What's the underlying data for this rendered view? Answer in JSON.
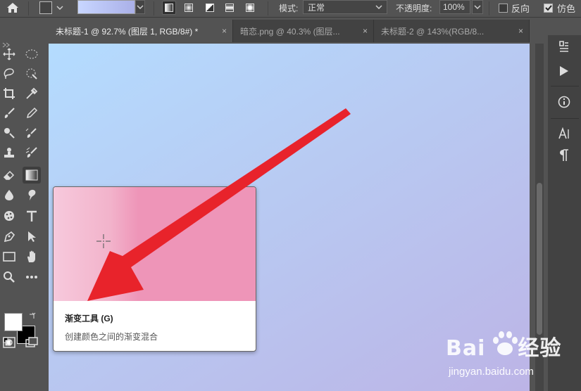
{
  "options_bar": {
    "mode_label": "模式:",
    "mode_value": "正常",
    "opacity_label": "不透明度:",
    "opacity_value": "100%",
    "reverse_label": "反向",
    "reverse_checked": false,
    "dither_label": "仿色",
    "dither_checked": true
  },
  "tabs": [
    {
      "label": "未标题-1 @ 92.7% (图层 1, RGB/8#) *",
      "active": true
    },
    {
      "label": "暗恋.png @ 40.3% (图层...",
      "active": false
    },
    {
      "label": "未标题-2 @ 143%(RGB/8...",
      "active": false
    }
  ],
  "tab_close_glyph": "×",
  "tooltip": {
    "title": "渐变工具 (G)",
    "description": "创建颜色之间的渐变混合"
  },
  "colors": {
    "foreground": "#ffffff",
    "background": "#000000",
    "arrow": "#e8232b"
  },
  "watermark": {
    "logo_left": "Bai",
    "logo_right": "经验",
    "url": "jingyan.baidu.com"
  }
}
